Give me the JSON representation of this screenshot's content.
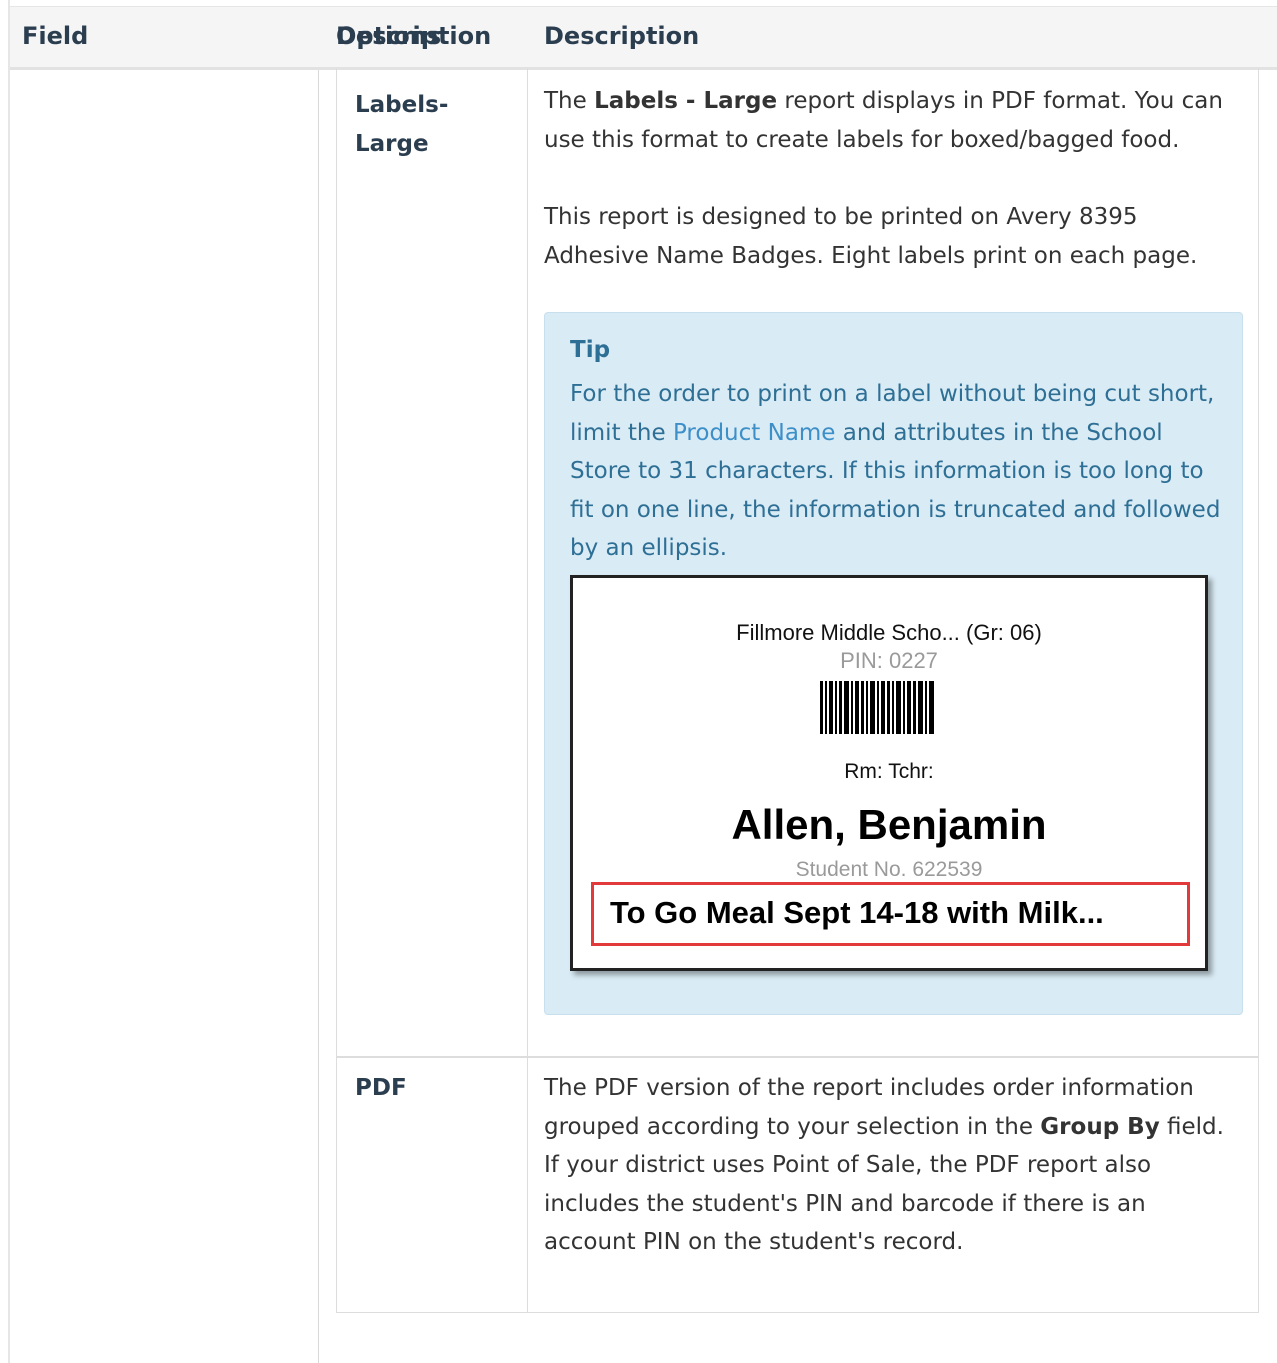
{
  "table": {
    "headers": {
      "field": "Field",
      "description_hidden": "Description",
      "options": "Options",
      "description": "Description"
    },
    "rows": [
      {
        "option": "Labels-\nLarge",
        "option_lines": [
          "Labels-",
          "Large"
        ],
        "para1": {
          "pre": "The ",
          "bold": "Labels - Large",
          "post": " report displays in PDF format. You can use this format to create labels for boxed/bagged food."
        },
        "para2": "This report is designed to be printed on Avery 8395 Adhesive Name Badges. Eight labels print on each page.",
        "tip": {
          "title": "Tip",
          "text_pre": "For the order to print on a label without being cut short, limit the ",
          "link": "Product Name",
          "text_post": " and attributes in the School Store to 31 characters. If this information is too long to fit on one line, the information is truncated and followed by an ellipsis."
        },
        "label_example": {
          "school": "Fillmore Middle Scho... (Gr: 06)",
          "pin": "PIN: 0227",
          "room": "Rm: Tchr:",
          "name": "Allen, Benjamin",
          "student_no": "Student No. 622539",
          "meal": "To Go Meal Sept 14-18 with Milk...",
          "highlight_color": "#e23a3a"
        }
      },
      {
        "option": "PDF",
        "para": {
          "pre": "The PDF version of the report includes order information grouped according to your selection in the ",
          "bold": "Group By",
          "post": " field. If your district uses Point of Sale, the PDF report also includes the student's PIN and barcode if there is an account PIN on the student's record."
        }
      }
    ]
  },
  "colors": {
    "header_bg": "#f5f5f5",
    "header_text": "#2b3e50",
    "tip_bg": "#d9ebf5",
    "tip_text": "#2e6f95",
    "link": "#3d8fc8"
  }
}
